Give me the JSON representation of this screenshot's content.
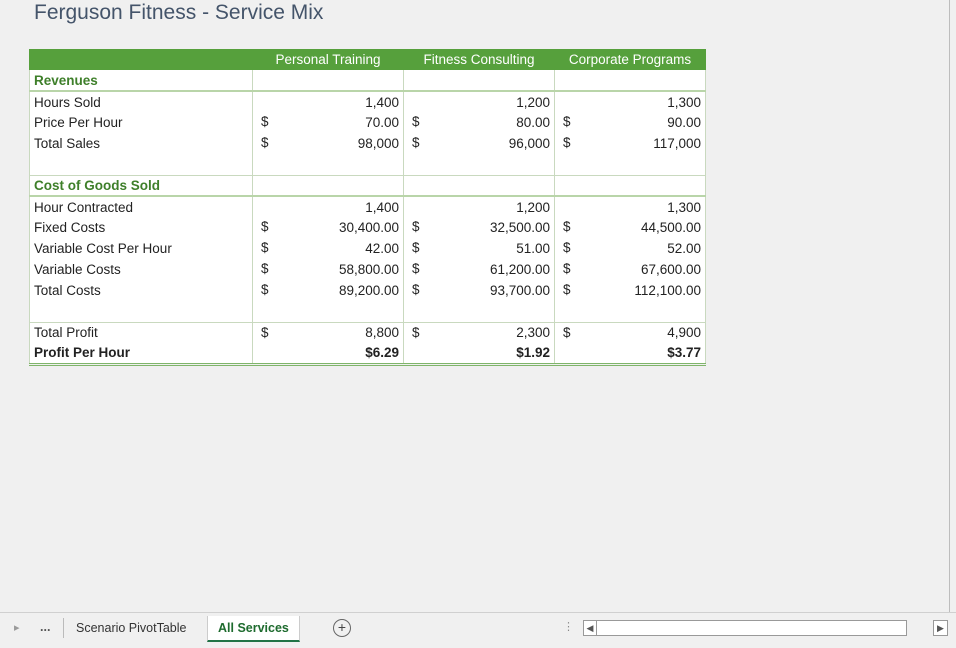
{
  "title": "Ferguson Fitness - Service Mix",
  "headers": [
    "",
    "Personal Training",
    "Fitness Consulting",
    "Corporate Programs"
  ],
  "revenues": {
    "section": "Revenues",
    "rows": [
      {
        "label": "Hours Sold",
        "cur": [
          "",
          "",
          ""
        ],
        "vals": [
          "1,400",
          "1,200",
          "1,300"
        ]
      },
      {
        "label": "Price Per Hour",
        "cur": [
          "$",
          "$",
          "$"
        ],
        "vals": [
          "70.00",
          "80.00",
          "90.00"
        ]
      },
      {
        "label": "Total Sales",
        "cur": [
          "$",
          "$",
          "$"
        ],
        "vals": [
          "98,000",
          "96,000",
          "117,000"
        ]
      }
    ]
  },
  "cogs": {
    "section": "Cost of Goods Sold",
    "rows": [
      {
        "label": "Hour Contracted",
        "cur": [
          "",
          "",
          ""
        ],
        "vals": [
          "1,400",
          "1,200",
          "1,300"
        ]
      },
      {
        "label": "Fixed Costs",
        "cur": [
          "$",
          "$",
          "$"
        ],
        "vals": [
          "30,400.00",
          "32,500.00",
          "44,500.00"
        ]
      },
      {
        "label": "Variable Cost Per Hour",
        "cur": [
          "$",
          "$",
          "$"
        ],
        "vals": [
          "42.00",
          "51.00",
          "52.00"
        ]
      },
      {
        "label": "Variable Costs",
        "cur": [
          "$",
          "$",
          "$"
        ],
        "vals": [
          "58,800.00",
          "61,200.00",
          "67,600.00"
        ]
      },
      {
        "label": "Total Costs",
        "cur": [
          "$",
          "$",
          "$"
        ],
        "vals": [
          "89,200.00",
          "93,700.00",
          "112,100.00"
        ]
      }
    ]
  },
  "profit": {
    "total": {
      "label": "Total Profit",
      "cur": [
        "$",
        "$",
        "$"
      ],
      "vals": [
        "8,800",
        "2,300",
        "4,900"
      ]
    },
    "per_hour": {
      "label": "Profit Per Hour",
      "vals": [
        "$6.29",
        "$1.92",
        "$3.77"
      ]
    }
  },
  "tabs": {
    "more": "...",
    "scenario": "Scenario PivotTable",
    "active": "All Services",
    "add": "+"
  },
  "colors": {
    "header_green": "#56a03c",
    "section_green": "#3e7f2a"
  }
}
